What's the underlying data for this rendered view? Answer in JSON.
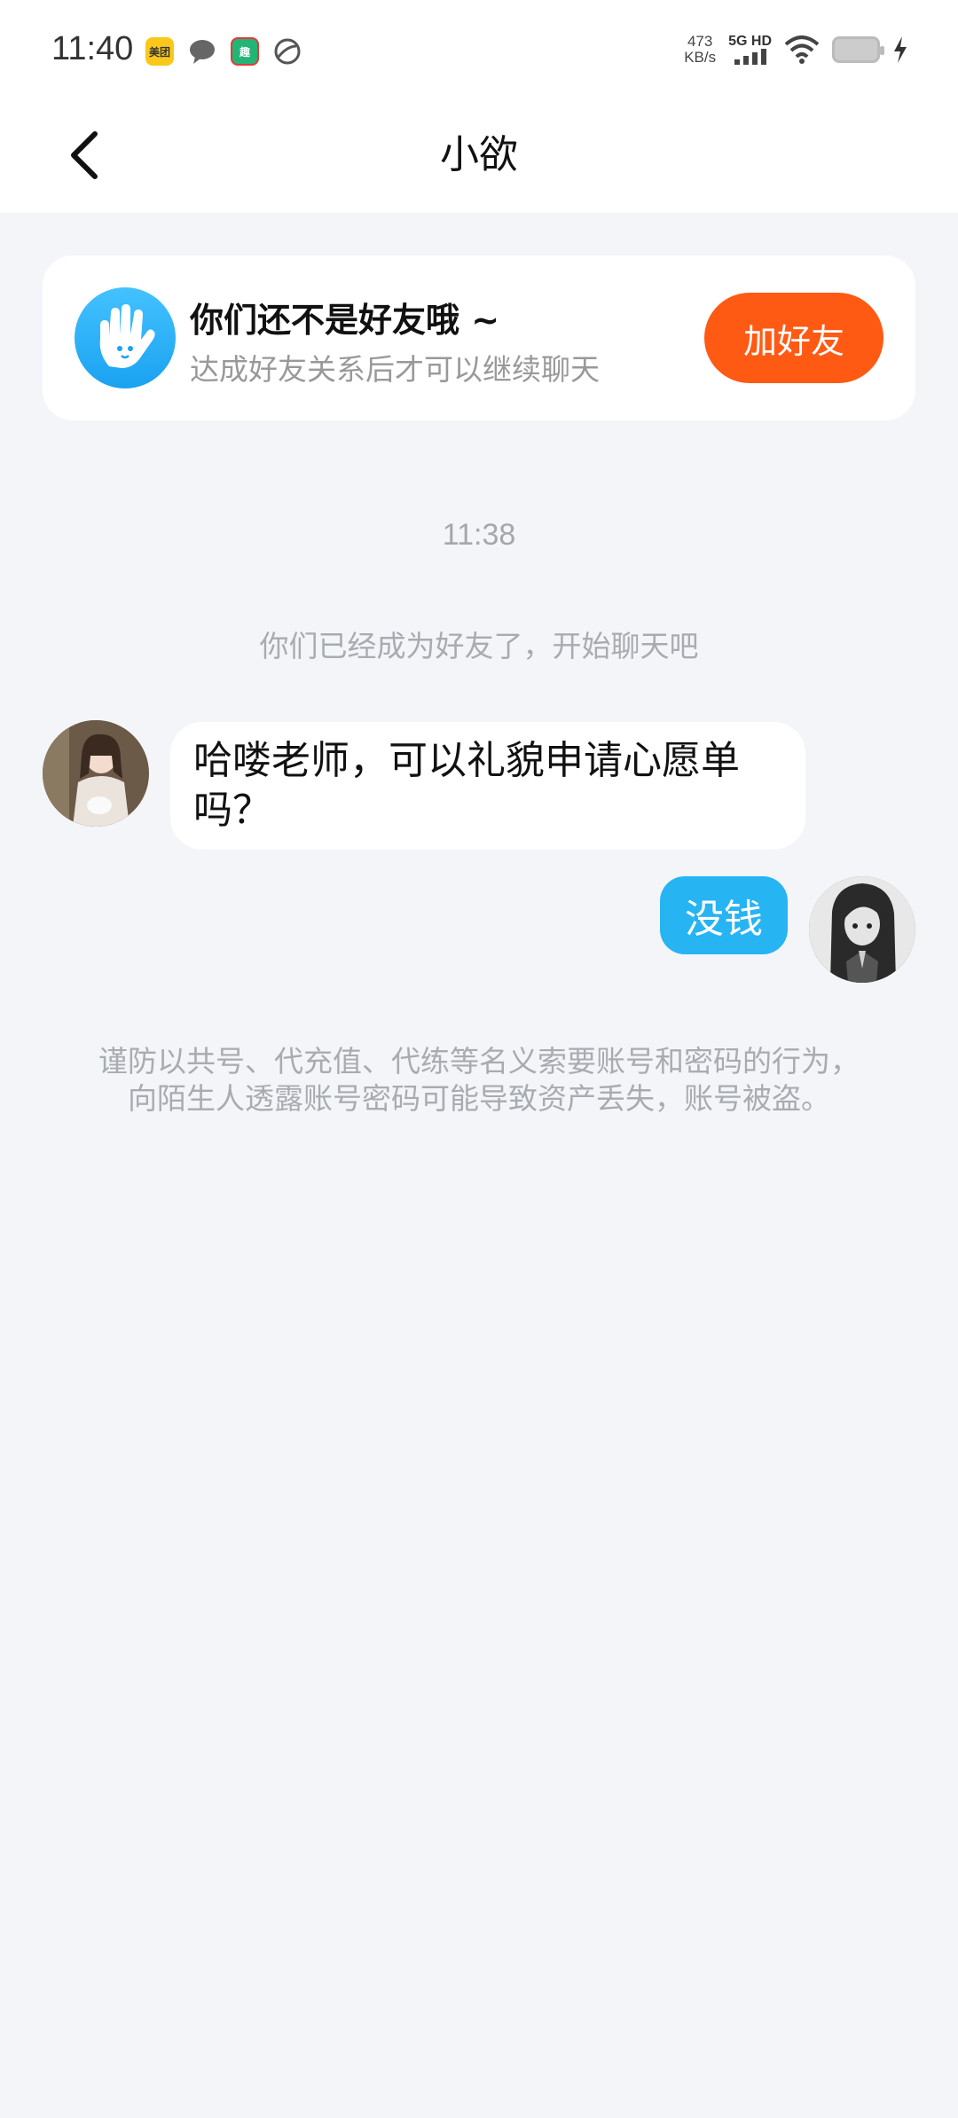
{
  "status_bar": {
    "time": "11:40",
    "notification_icons": [
      "meituan-icon",
      "message-icon",
      "qu-app-icon",
      "ball-icon"
    ],
    "meituan_label": "美团",
    "qu_label": "趣",
    "net_speed_value": "473",
    "net_speed_unit": "KB/s",
    "signal_label": "5G HD"
  },
  "nav": {
    "title": "小欲"
  },
  "friend_card": {
    "title": "你们还不是好友哦 ~",
    "subtitle": "达成好友关系后才可以继续聊天",
    "button_label": "加好友",
    "button_color": "#ff5a14"
  },
  "chat": {
    "timestamp": "11:38",
    "system_message": "你们已经成为好友了，开始聊天吧",
    "messages": [
      {
        "side": "left",
        "text": "哈喽老师，可以礼貌申请心愿单吗？"
      },
      {
        "side": "right",
        "text": "没钱"
      }
    ],
    "right_bubble_color": "#26b4f3"
  },
  "warning": "谨防以共号、代充值、代练等名义索要账号和密码的行为，向陌生人透露账号密码可能导致资产丢失，账号被盗。"
}
